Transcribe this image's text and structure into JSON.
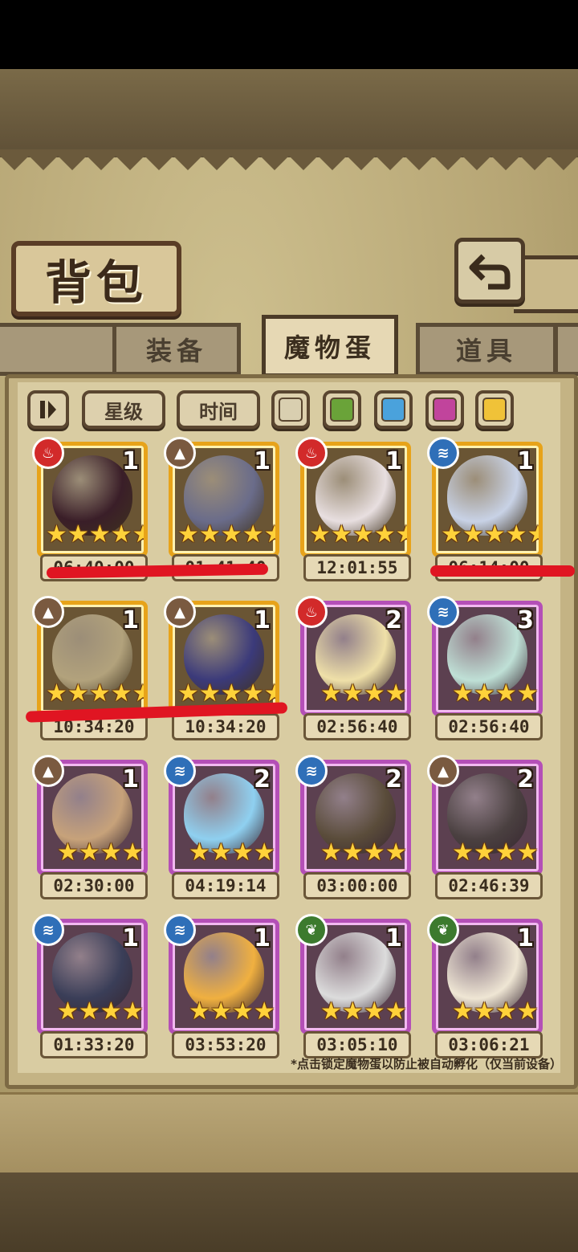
{
  "title": "背包",
  "tabs": [
    {
      "label": "装备",
      "active": false
    },
    {
      "label": "魔物蛋",
      "active": true
    },
    {
      "label": "道具",
      "active": false
    }
  ],
  "filters": {
    "sort_icon": "pause-sort-icon",
    "star_label": "星级",
    "time_label": "时间",
    "color_swatches": [
      "#d9cfb0",
      "#6aa339",
      "#4aa2dc",
      "#c1449c",
      "#f0c238"
    ]
  },
  "colors": {
    "fire": "#d22a2a",
    "earth": "#7a5a40",
    "water": "#2f6fb8",
    "grass": "#3c7a2e",
    "gold_frame": "#e7a31a",
    "purple_frame": "#b44fb7"
  },
  "eggs": [
    {
      "element": "fire-icon",
      "elemColor": "#d22a2a",
      "count": "1",
      "stars": 5,
      "timer": "06:40:00",
      "frame": "gold",
      "eggColor": "#3a1e28"
    },
    {
      "element": "mountain-icon",
      "elemColor": "#7a5a40",
      "count": "1",
      "stars": 5,
      "timer": "01:41:40",
      "frame": "gold",
      "eggColor": "#6a6c8a"
    },
    {
      "element": "fire-icon",
      "elemColor": "#d22a2a",
      "count": "1",
      "stars": 5,
      "timer": "12:01:55",
      "frame": "gold",
      "eggColor": "#e8dfe0"
    },
    {
      "element": "water-icon",
      "elemColor": "#2f6fb8",
      "count": "1",
      "stars": 5,
      "timer": "06:14:00",
      "frame": "gold",
      "eggColor": "#c8d2e6"
    },
    {
      "element": "mountain-icon",
      "elemColor": "#7a5a40",
      "count": "1",
      "stars": 5,
      "timer": "10:34:20",
      "frame": "gold",
      "eggColor": "#b2a27c"
    },
    {
      "element": "mountain-icon",
      "elemColor": "#7a5a40",
      "count": "1",
      "stars": 5,
      "timer": "10:34:20",
      "frame": "gold",
      "eggColor": "#3b3a7a"
    },
    {
      "element": "fire-icon",
      "elemColor": "#d22a2a",
      "count": "2",
      "stars": 4,
      "timer": "02:56:40",
      "frame": "purple",
      "eggColor": "#efe0a8"
    },
    {
      "element": "water-icon",
      "elemColor": "#2f6fb8",
      "count": "3",
      "stars": 4,
      "timer": "02:56:40",
      "frame": "purple",
      "eggColor": "#bfe0d6"
    },
    {
      "element": "mountain-icon",
      "elemColor": "#7a5a40",
      "count": "1",
      "stars": 4,
      "timer": "02:30:00",
      "frame": "purple",
      "eggColor": "#c7a27a"
    },
    {
      "element": "water-icon",
      "elemColor": "#2f6fb8",
      "count": "2",
      "stars": 4,
      "timer": "04:19:14",
      "frame": "purple",
      "eggColor": "#8fd0f0"
    },
    {
      "element": "water-icon",
      "elemColor": "#2f6fb8",
      "count": "2",
      "stars": 4,
      "timer": "03:00:00",
      "frame": "purple",
      "eggColor": "#5a4c3a"
    },
    {
      "element": "mountain-icon",
      "elemColor": "#7a5a40",
      "count": "2",
      "stars": 4,
      "timer": "02:46:39",
      "frame": "purple",
      "eggColor": "#4a4040"
    },
    {
      "element": "water-icon",
      "elemColor": "#2f6fb8",
      "count": "1",
      "stars": 4,
      "timer": "01:33:20",
      "frame": "purple",
      "eggColor": "#3a3e58"
    },
    {
      "element": "water-icon",
      "elemColor": "#2f6fb8",
      "count": "1",
      "stars": 4,
      "timer": "03:53:20",
      "frame": "purple",
      "eggColor": "#f0b040"
    },
    {
      "element": "leaf-icon",
      "elemColor": "#3c7a2e",
      "count": "1",
      "stars": 4,
      "timer": "03:05:10",
      "frame": "purple",
      "eggColor": "#dcdcdc"
    },
    {
      "element": "leaf-icon",
      "elemColor": "#3c7a2e",
      "count": "1",
      "stars": 4,
      "timer": "03:06:21",
      "frame": "purple",
      "eggColor": "#efe6d4"
    }
  ],
  "note": "*点击锁定魔物蛋以防止被自动孵化（仅当前设备）"
}
